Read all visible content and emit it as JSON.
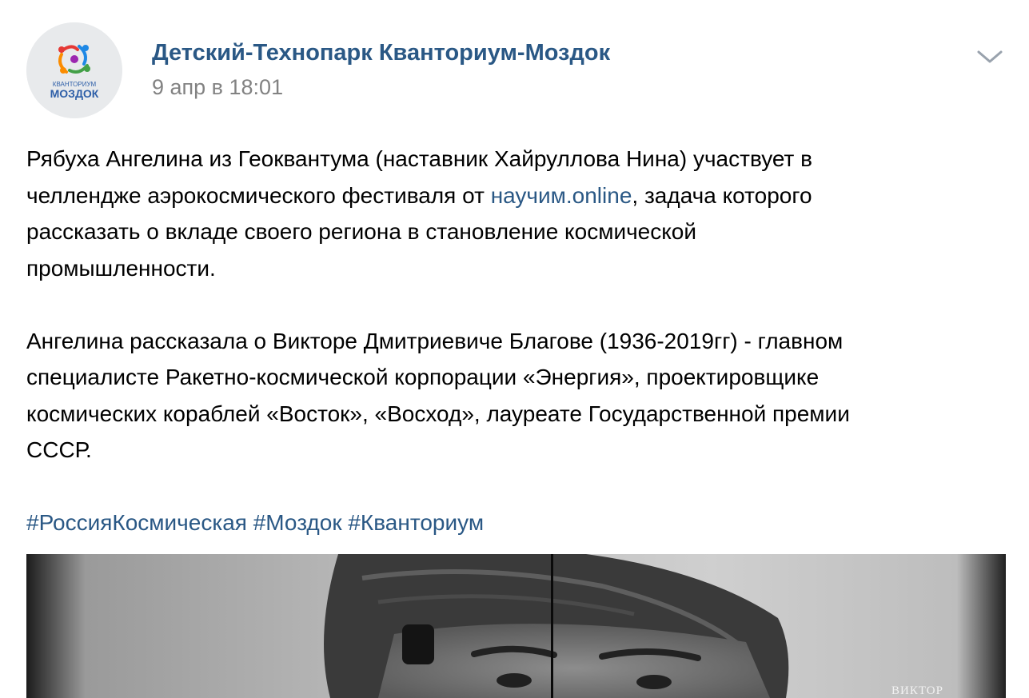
{
  "post": {
    "author": "Детский-Технопарк Кванториум-Моздок",
    "date": "9 апр в 18:01",
    "avatar": {
      "logo_top": "КВАНТОРИУМ",
      "logo_bottom": "МОЗДОК",
      "colors": {
        "red": "#e53935",
        "blue": "#1e88e5",
        "green": "#43a047",
        "orange": "#fb8c00",
        "text": "#2e5fa8"
      }
    },
    "menu_icon": "chevron-down-icon",
    "paragraph1": {
      "line1": "Рябуха Ангелина из Геоквантума (наставник Хайруллова Нина) участвует в",
      "line2_before": "челлендже аэрокосмического фестиваля от ",
      "line2_link": "научим.online",
      "line2_after": ", задача которого",
      "line3": "рассказать о вкладе своего региона в становление космической",
      "line4": "промышленности."
    },
    "paragraph2": {
      "line1": "Ангелина рассказала о Викторе Дмитриевиче Благове (1936-2019гг) - главном",
      "line2": "специалисте Ракетно-космической корпорации «Энергия», проектировщике",
      "line3": "космических кораблей «Восток», «Восход», лауреате Государственной премии",
      "line4": "СССР."
    },
    "hashtags": [
      "#РоссияКосмическая",
      "#Моздок",
      "#Кванториум"
    ],
    "photo": {
      "caption": "ВИКТОР"
    }
  },
  "colors": {
    "link": "#2a5885",
    "meta": "#828282",
    "text": "#000000"
  }
}
